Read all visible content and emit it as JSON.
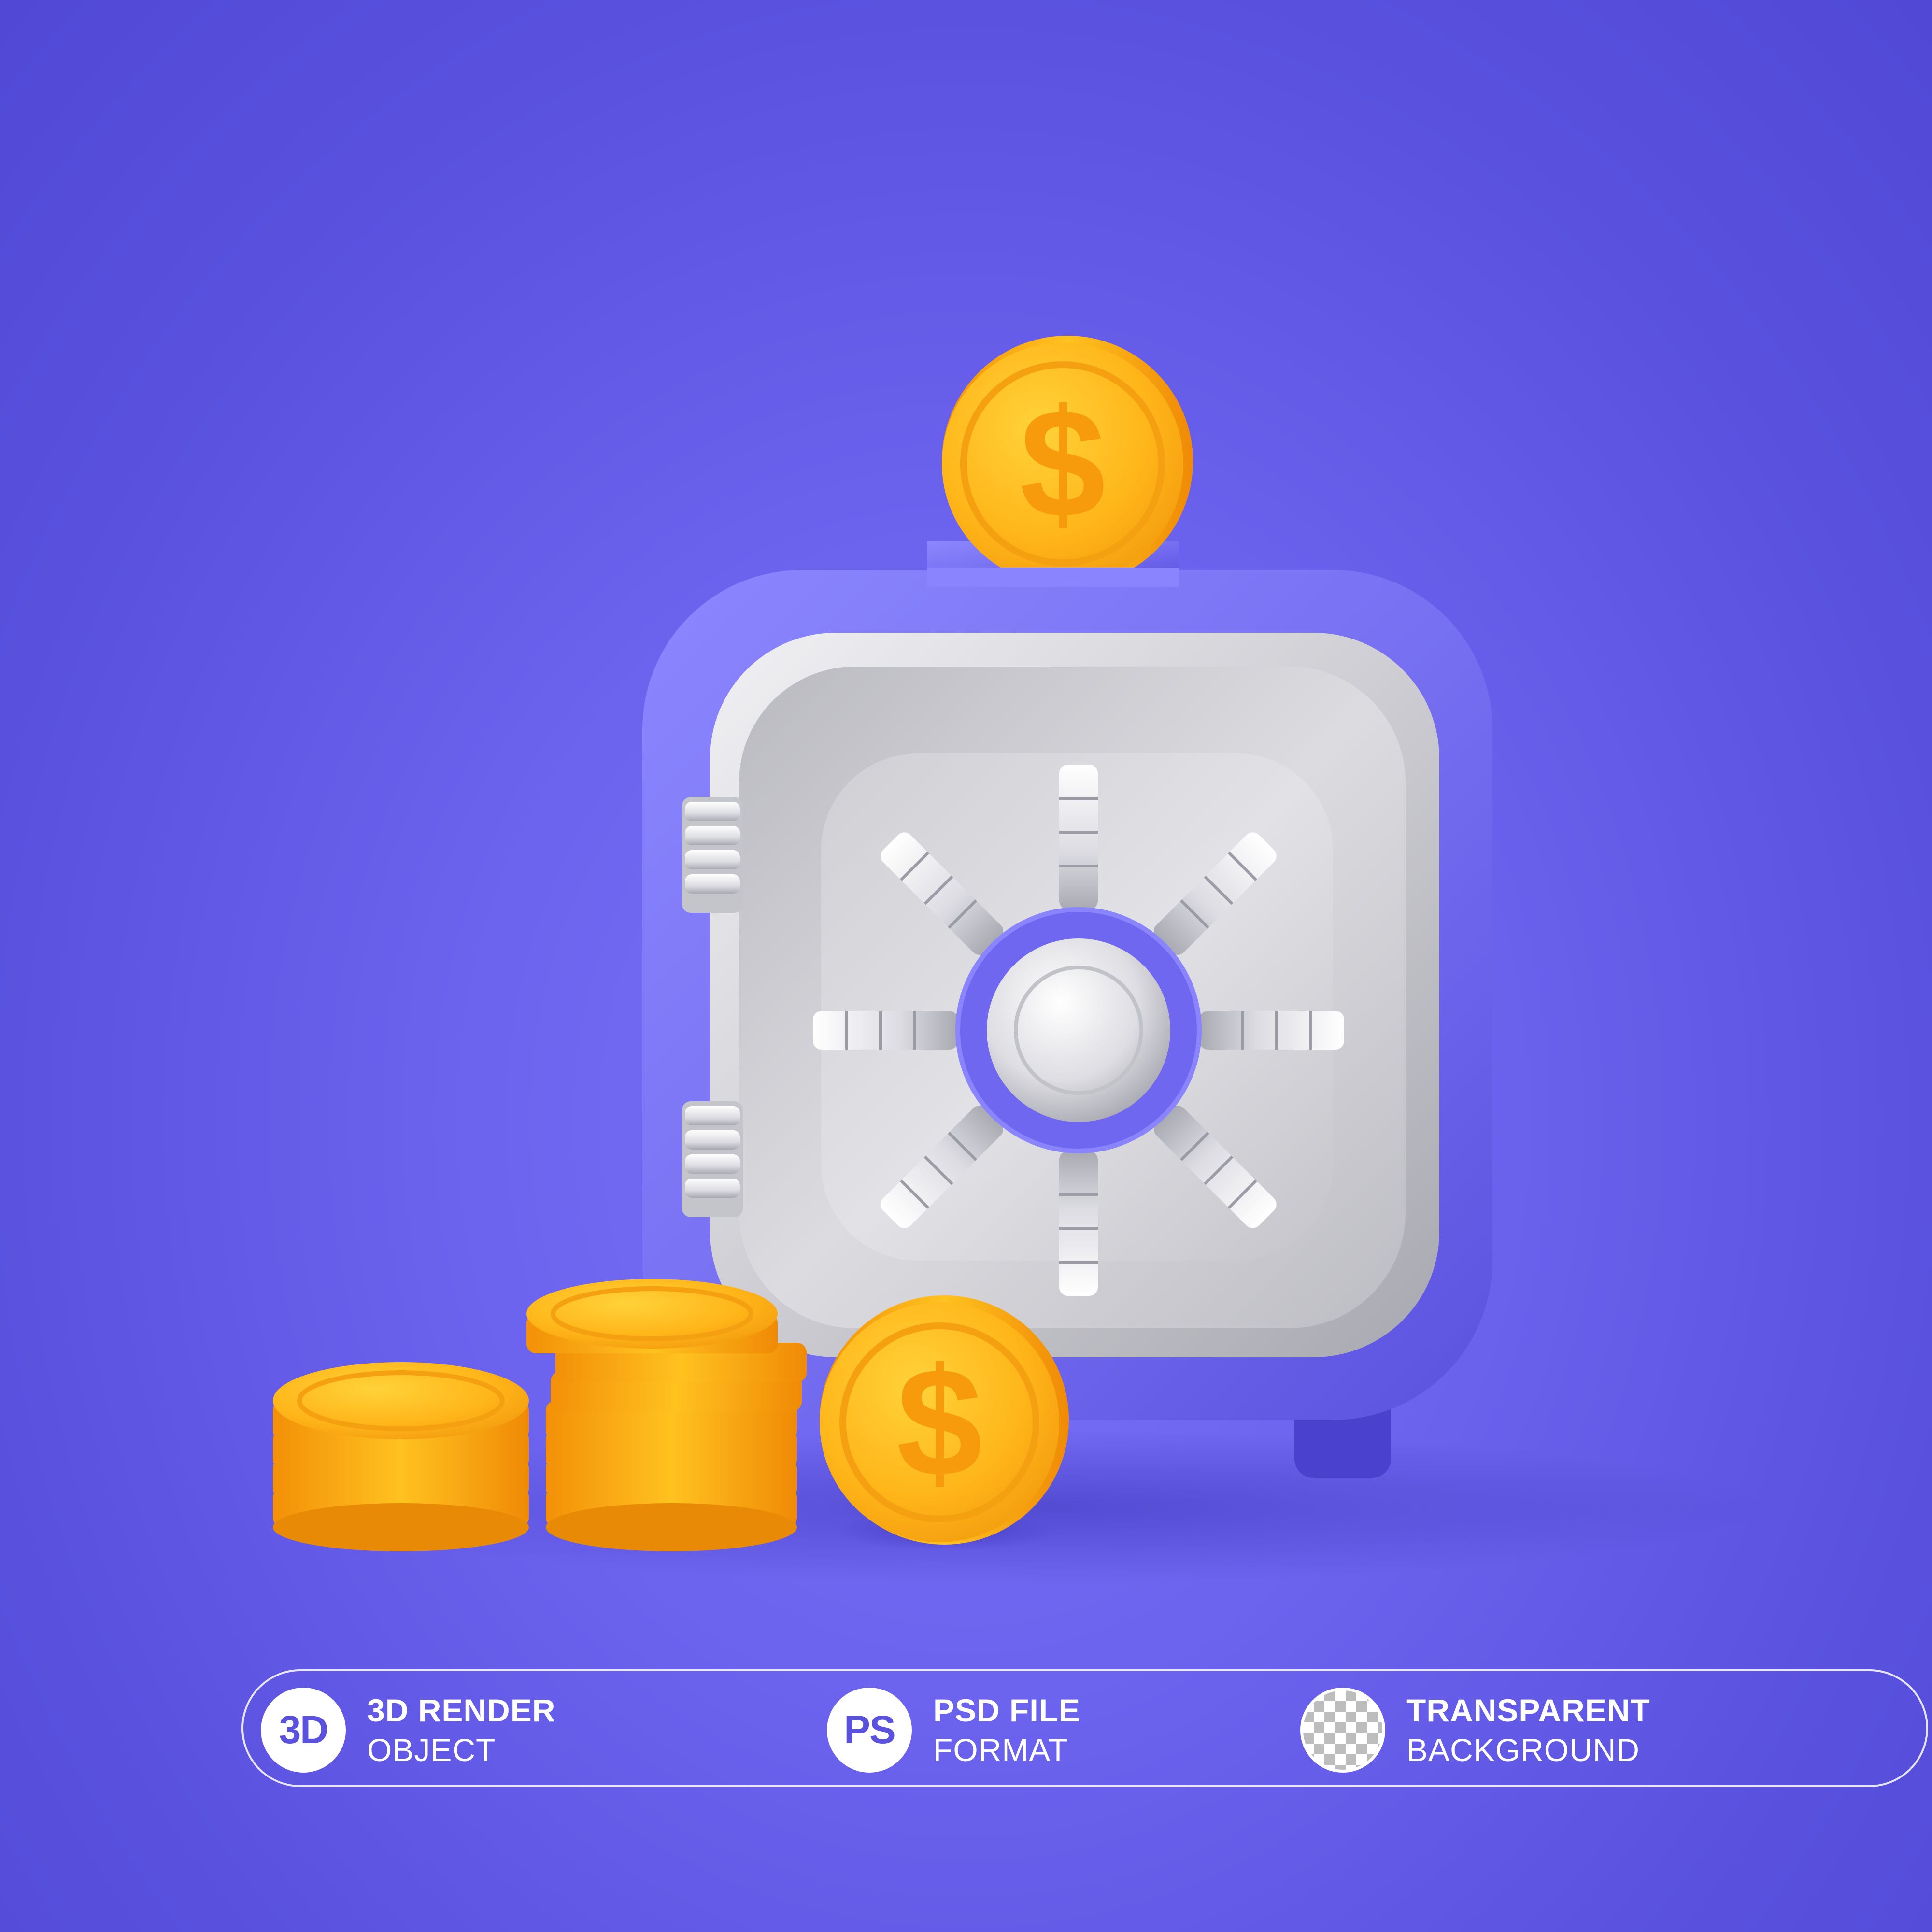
{
  "colors": {
    "background": "#6b63ee",
    "safe_body": "#7a74f2",
    "safe_door": "#d6d6dc",
    "coin_gold": "#ffb619",
    "coin_orange": "#f7930c",
    "badge_outline": "#ffffff"
  },
  "coin_symbol": "$",
  "badges": [
    {
      "icon_text": "3D",
      "line1": "3D RENDER",
      "line2": "OBJECT"
    },
    {
      "icon_text": "PS",
      "line1": "PSD FILE",
      "line2": "FORMAT"
    },
    {
      "icon_text": "",
      "icon": "transparency-checkerboard-icon",
      "line1": "TRANSPARENT",
      "line2": "BACKGROUND"
    }
  ]
}
